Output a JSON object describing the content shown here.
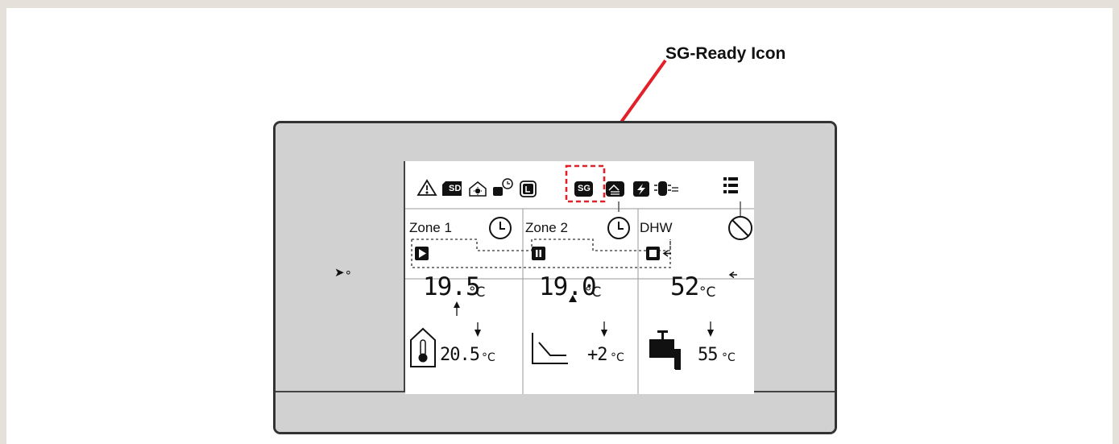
{
  "annotation": {
    "label": "SG-Ready Icon",
    "color": "#e3202a"
  },
  "device": {
    "led_symbol": "➤∘",
    "icons": [
      "warning-icon",
      "sd-card-icon",
      "house-sun-icon",
      "schedule-device-icon",
      "lock-icon",
      "sg-ready-icon",
      "house-exchange-icon",
      "power-bolt-icon",
      "tank-exchange-icon",
      "menu-icon"
    ],
    "sd_label": "SD",
    "sg_label": "SG"
  },
  "zones": [
    {
      "name": "Zone 1",
      "temperature": "19.5",
      "unit": "°C",
      "setpoint": "20.5",
      "setpoint_unit": "°C",
      "status": "play",
      "mode_icon": "clock-icon"
    },
    {
      "name": "Zone 2",
      "temperature": "19.0",
      "unit": "°C",
      "setpoint": "+2",
      "setpoint_unit": "°C",
      "status": "pause",
      "mode_icon": "clock-icon"
    },
    {
      "name": "DHW",
      "temperature": "52",
      "unit": "°C",
      "setpoint": "55",
      "setpoint_unit": "°C",
      "status": "stop",
      "mode_icon": "no-entry-icon"
    }
  ]
}
